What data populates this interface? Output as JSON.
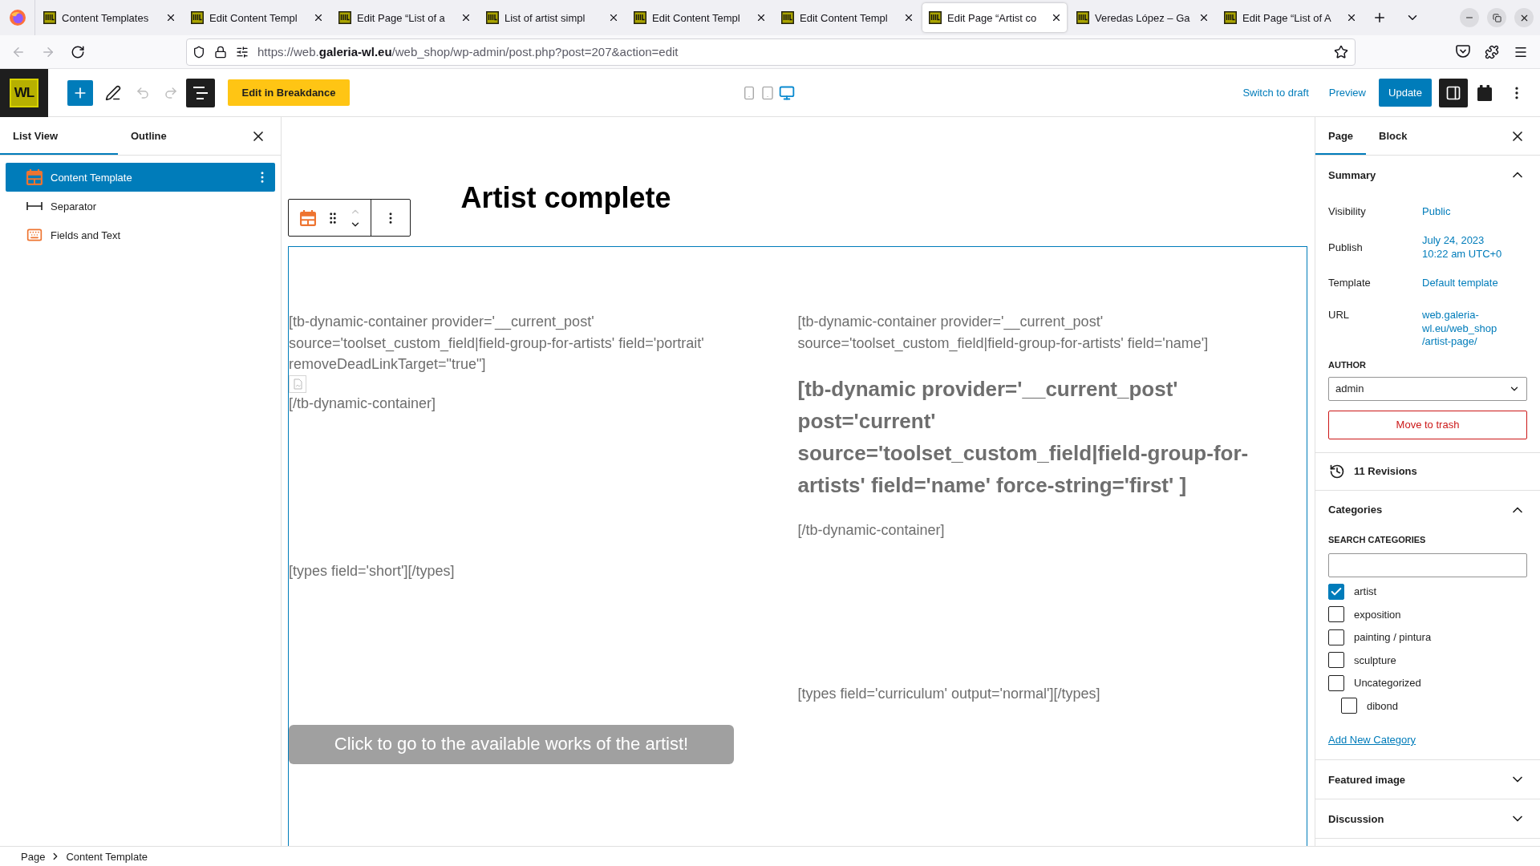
{
  "browser": {
    "tabs": [
      {
        "title": "Content Templates",
        "selected": false
      },
      {
        "title": "Edit Content Templ",
        "selected": false
      },
      {
        "title": "Edit Page “List of a",
        "selected": false
      },
      {
        "title": "List of artist simpl",
        "selected": false
      },
      {
        "title": "Edit Content Templ",
        "selected": false
      },
      {
        "title": "Edit Content Templ",
        "selected": false
      },
      {
        "title": "Edit Page “Artist co",
        "selected": true
      },
      {
        "title": "Veredas López – Ga",
        "selected": false
      },
      {
        "title": "Edit Page “List of A",
        "selected": false
      }
    ],
    "nav": [
      {
        "kind": "back",
        "disabled": true
      },
      {
        "kind": "forward",
        "disabled": true
      },
      {
        "kind": "reload",
        "disabled": false
      }
    ],
    "address": "https://web.**galeria-wl.eu**/web_shop/wp-admin/post.php?post=207&action=edit"
  },
  "header": {
    "logo": "WL",
    "history": [
      {
        "kind": "undo",
        "disabled": true
      },
      {
        "kind": "redo",
        "disabled": true
      }
    ],
    "list_view_pressed": true,
    "breakdance_button": "Edit in Breakdance",
    "devices": [
      {
        "kind": "mobile",
        "selected": false
      },
      {
        "kind": "tablet",
        "selected": false
      },
      {
        "kind": "desktop",
        "selected": true
      }
    ],
    "switch_to_draft": "Switch to draft",
    "preview": "Preview",
    "update": "Update",
    "settings_pressed": true
  },
  "list_view": {
    "tabs": [
      {
        "label": "List View",
        "selected": true
      },
      {
        "label": "Outline",
        "selected": false
      }
    ],
    "items": [
      {
        "label": "Content Template",
        "kind": "template",
        "selected": true
      },
      {
        "label": "Separator",
        "kind": "separator",
        "selected": false
      },
      {
        "label": "Fields and Text",
        "kind": "fields",
        "selected": false
      }
    ]
  },
  "canvas": {
    "title": "Artist complete",
    "block_toolbar": {
      "move_up_disabled": true,
      "move_down_disabled": false
    },
    "rows": [
      {
        "columns": [
          [
            {
              "kind": "text",
              "text": "[tb-dynamic-container provider='__current_post' source='toolset_custom_field|field-group-for-artists' field='portrait' removeDeadLinkTarget=\"true\"]"
            },
            {
              "kind": "image"
            },
            {
              "kind": "text",
              "text": "[/tb-dynamic-container]"
            }
          ],
          [
            {
              "kind": "text",
              "text": "[tb-dynamic-container provider='__current_post' source='toolset_custom_field|field-group-for-artists' field='name']"
            },
            {
              "kind": "heading",
              "text": "[tb-dynamic provider='__current_post' post='current' source='toolset_custom_field|field-group-for-artists' field='name' force-string='first' ]"
            },
            {
              "kind": "text",
              "text": "[/tb-dynamic-container]"
            }
          ]
        ]
      },
      {
        "columns": [
          [
            {
              "kind": "text",
              "text": "[types field='short'][/types]"
            }
          ],
          [
            {
              "kind": "text",
              "text": "[types field='curriculum' output='normal'][/types]"
            }
          ]
        ]
      }
    ],
    "button": "Click to go to the available works of the artist!"
  },
  "settings": {
    "tabs": [
      {
        "label": "Page",
        "selected": true
      },
      {
        "label": "Block",
        "selected": false
      }
    ],
    "summary": {
      "title": "Summary",
      "expanded": true,
      "rows": [
        {
          "label": "Visibility",
          "value": "Public"
        },
        {
          "label": "Publish",
          "value": "July 24, 2023\n10:22 am UTC+0"
        },
        {
          "label": "Template",
          "value": "Default template"
        },
        {
          "label": "URL",
          "value": "web.galeria-\nwl.eu/web_shop\n/artist-page/"
        }
      ],
      "author_label": "AUTHOR",
      "author": "admin",
      "trash": "Move to trash"
    },
    "revisions": "11 Revisions",
    "categories": {
      "title": "Categories",
      "expanded": true,
      "search_label": "SEARCH CATEGORIES",
      "items": [
        {
          "label": "artist",
          "checked": true
        },
        {
          "label": "exposition",
          "checked": false
        },
        {
          "label": "painting / pintura",
          "checked": false
        },
        {
          "label": "sculpture",
          "checked": false
        },
        {
          "label": "Uncategorized",
          "checked": false,
          "children": [
            {
              "label": "dibond",
              "checked": false
            }
          ]
        }
      ],
      "add_new": "Add New Category"
    },
    "panels": [
      {
        "title": "Featured image",
        "expanded": false
      },
      {
        "title": "Discussion",
        "expanded": false
      }
    ]
  },
  "breadcrumb": [
    "Page",
    "Content Template"
  ]
}
